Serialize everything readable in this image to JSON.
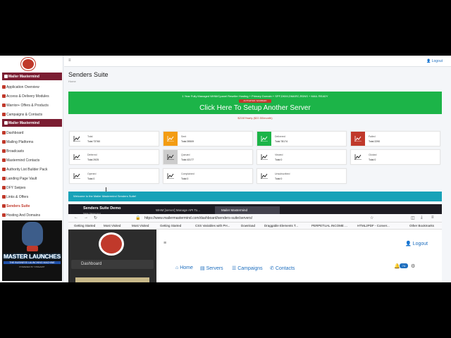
{
  "sidebar": {
    "items": [
      {
        "label": "Mailer Mastermind",
        "style": "hl"
      },
      {
        "label": "Application Overview"
      },
      {
        "label": "Access & Delivery Modules"
      },
      {
        "label": "Warrior+ Offers & Products"
      },
      {
        "label": "Campaigns & Contacts"
      },
      {
        "label": "Mailer Mastermind",
        "style": "hl"
      },
      {
        "label": "Dashboard"
      },
      {
        "label": "Mailing Platforms"
      },
      {
        "label": "Broadcasts"
      },
      {
        "label": "Mastermind Contacts"
      },
      {
        "label": "Authority List Builder Pack"
      },
      {
        "label": "Landing Page Vault"
      },
      {
        "label": "DFY Swipes"
      },
      {
        "label": "Links & Offers"
      },
      {
        "label": "Senders Suite",
        "style": "active"
      },
      {
        "label": "Hosting And Domains"
      }
    ],
    "banner": {
      "title": "MASTER LAUNCHES",
      "subtitle": "THE BUSINESS LAUNCHING MACHINE",
      "powered": "POWERED BY STREAMIT"
    }
  },
  "topbar": {
    "logout": "Logout"
  },
  "page": {
    "title": "Senders Suite",
    "breadcrumb": "Home"
  },
  "promo": {
    "line1": "1 Year Fully Managed WHM/Cpanel Reseller Hosting + Primary Domain + SPF,DKIM,DMARC,RDNS + MAIL READY",
    "badge": "ACTIVATED / ENABLED",
    "cta": "Click Here To Setup Another Server",
    "price": "$219/Yearly ($22.50/month)"
  },
  "stats": [
    {
      "label": "Total",
      "value": "Total 73760",
      "color": "#ffffff"
    },
    {
      "label": "Sent",
      "value": "Total 39509",
      "color": "#f39c12"
    },
    {
      "label": "Delivered",
      "value": "Total 78174",
      "color": "#1cb448"
    },
    {
      "label": "Failed",
      "value": "Total 2290",
      "color": "#c0392b"
    },
    {
      "label": "Deferred",
      "value": "Total 2925",
      "color": "#ffffff"
    },
    {
      "label": "Queued",
      "value": "Total 43177",
      "color": "#cccccc"
    },
    {
      "label": "Viewed",
      "value": "Total 0",
      "color": "#ffffff"
    },
    {
      "label": "Clicked",
      "value": "Total 0",
      "color": "#ffffff"
    },
    {
      "label": "Opened",
      "value": "Total 0",
      "color": "#ffffff"
    },
    {
      "label": "Complained",
      "value": "Total 0",
      "color": "#ffffff"
    },
    {
      "label": "Unsubscribed",
      "value": "Total 0",
      "color": "#ffffff"
    }
  ],
  "welcome": "Welcome to the Mailer Mastermind Senders Suite!",
  "embed": {
    "tabs": [
      {
        "label": "Senders Suite Demo",
        "sub": "Mailer Mastermind"
      },
      {
        "label": "WHM [server] Manage API To..."
      },
      {
        "label": "Mailer Mastermind"
      }
    ],
    "url": "https://www.mailermastermind.com/dashboard/senders-suite/servers/",
    "bookmarks": [
      "Getting Started",
      "Most Visited",
      "Most Visited",
      "Getting Started",
      "CSS Variables with PH...",
      "Download",
      "Draggable Elements T...",
      "PERPETUAL INCOME ...",
      "HTML2PDF - Conver...",
      "Other Bookmarks"
    ],
    "sidebar_dashboard": "Dashboard",
    "logout": "Logout",
    "menu": [
      "Home",
      "Servers",
      "Campaigns",
      "Contacts"
    ],
    "badge": "74"
  }
}
